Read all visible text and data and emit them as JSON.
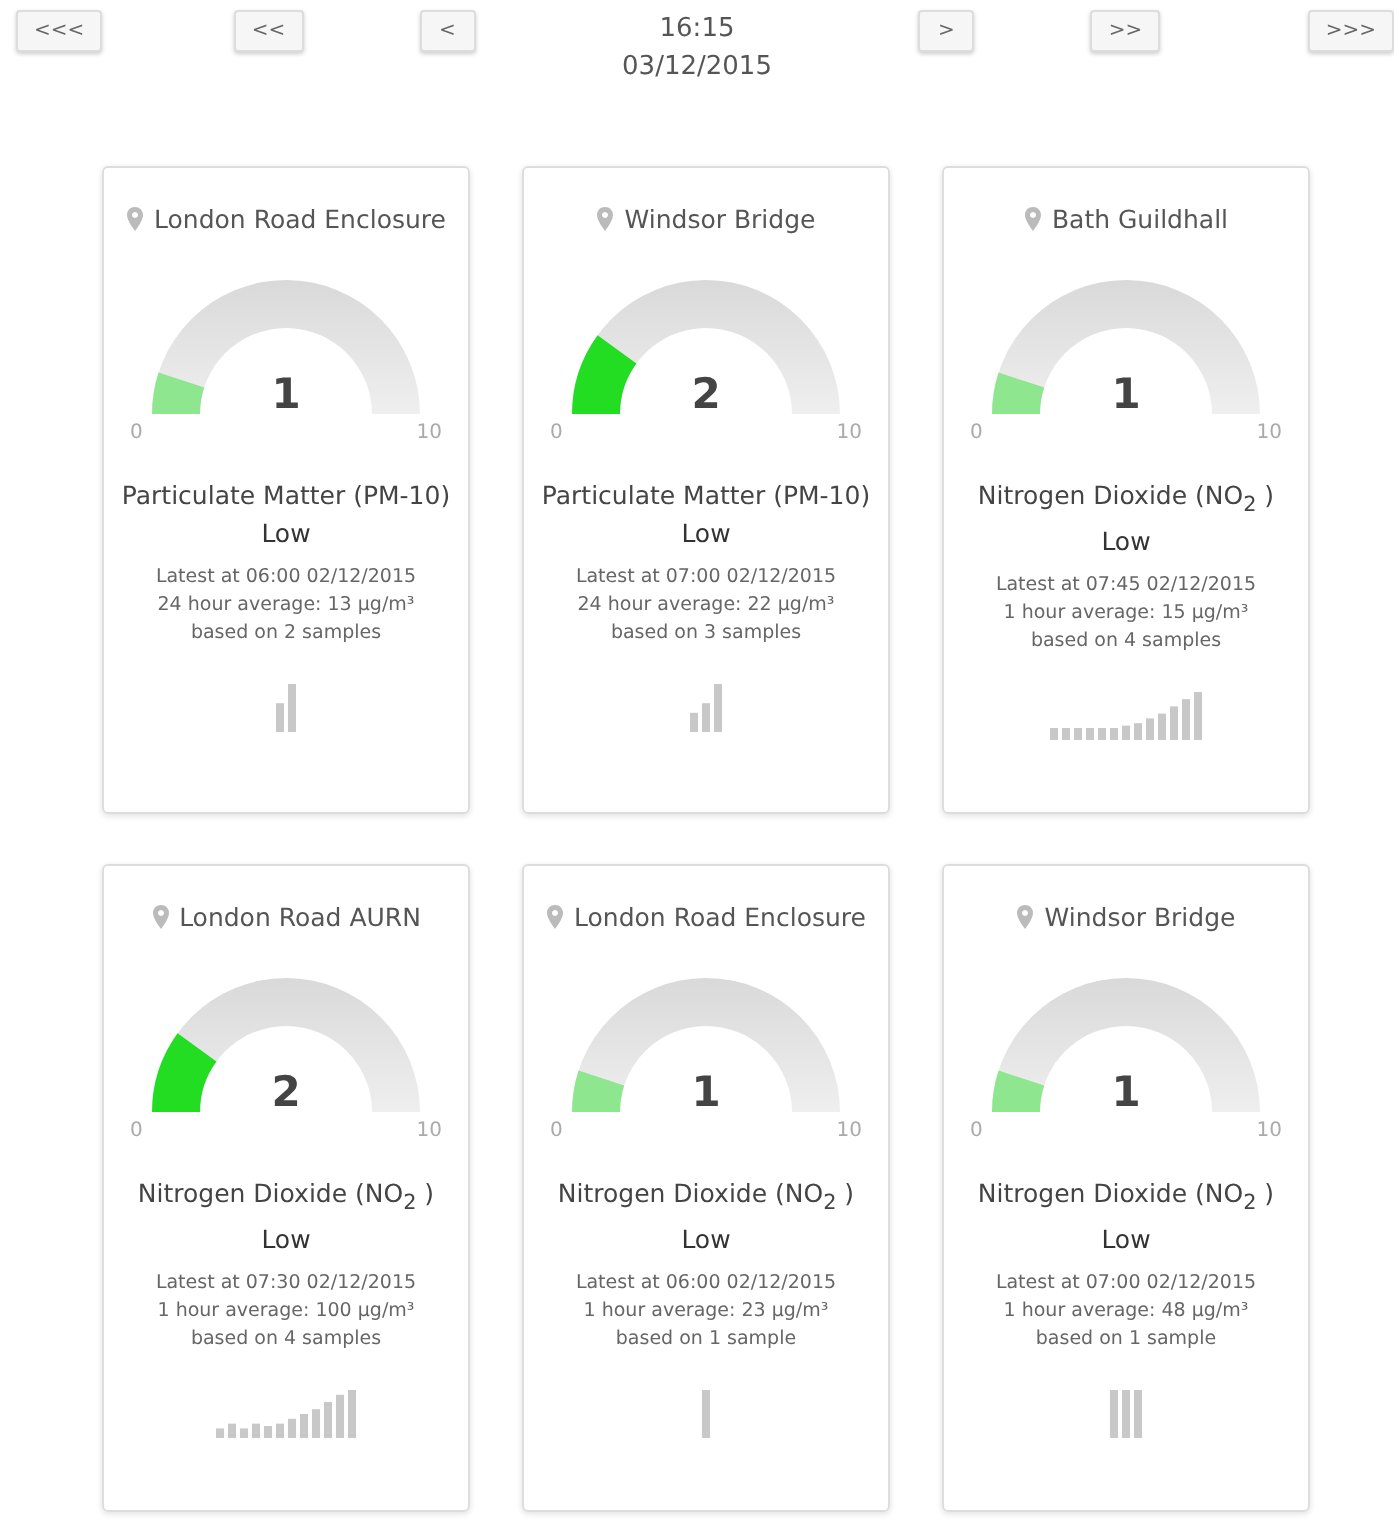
{
  "nav": {
    "buttons": [
      "<<<",
      "<<",
      "<"
    ],
    "time": "16:15",
    "date": "03/12/2015",
    "buttons_right": [
      ">",
      ">>",
      ">>>"
    ]
  },
  "cards": [
    {
      "site": "London Road Enclosure",
      "value": "1",
      "color": "#8ee68e",
      "min": "0",
      "max": "10",
      "pollutant": "Particulate Matter (PM-10)",
      "band": "Low",
      "latest": "Latest at 06:00 02/12/2015",
      "average": "24 hour average: 13 µg/m³",
      "samples": "based on 2 samples"
    },
    {
      "site": "Windsor Bridge",
      "value": "2",
      "color": "#22dd22",
      "min": "0",
      "max": "10",
      "pollutant": "Particulate Matter (PM-10)",
      "band": "Low",
      "latest": "Latest at 07:00 02/12/2015",
      "average": "24 hour average: 22 µg/m³",
      "samples": "based on 3 samples"
    },
    {
      "site": "Bath Guildhall",
      "value": "1",
      "color": "#8ee68e",
      "min": "0",
      "max": "10",
      "pollutant": "Nitrogen Dioxide (NO$_{2}$ )",
      "band": "Low",
      "latest": "Latest at 07:45 02/12/2015",
      "average": "1 hour average: 15 µg/m³",
      "samples": "based on 4 samples"
    },
    {
      "site": "London Road AURN",
      "value": "2",
      "color": "#22dd22",
      "min": "0",
      "max": "10",
      "pollutant": "Nitrogen Dioxide (NO$_{2}$ )",
      "band": "Low",
      "latest": "Latest at 07:30 02/12/2015",
      "average": "1 hour average: 100 µg/m³",
      "samples": "based on 4 samples"
    },
    {
      "site": "London Road Enclosure",
      "value": "1",
      "color": "#8ee68e",
      "min": "0",
      "max": "10",
      "pollutant": "Nitrogen Dioxide (NO$_{2}$ )",
      "band": "Low",
      "latest": "Latest at 06:00 02/12/2015",
      "average": "1 hour average: 23 µg/m³",
      "samples": "based on 1 sample"
    },
    {
      "site": "Windsor Bridge",
      "value": "1",
      "color": "#8ee68e",
      "min": "0",
      "max": "10",
      "pollutant": "Nitrogen Dioxide (NO$_{2}$ )",
      "band": "Low",
      "latest": "Latest at 07:00 02/12/2015",
      "average": "1 hour average: 48 µg/m³",
      "samples": "based on 1 sample"
    }
  ]
}
